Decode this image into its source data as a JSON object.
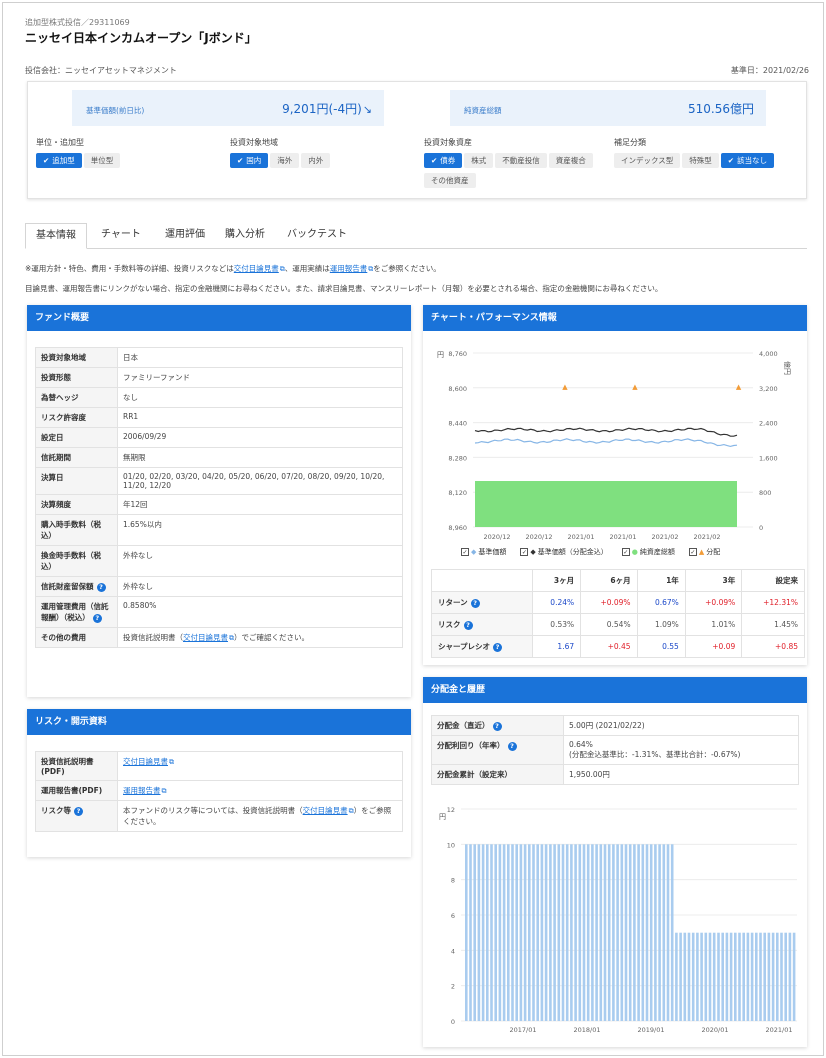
{
  "header": {
    "breadcrumb": "追加型株式投信／29311069",
    "title": "ニッセイ日本インカムオープン「Jボンド」",
    "company": "投信会社：ニッセイアセットマネジメント",
    "base_date": "基準日：2021/02/26"
  },
  "summary": {
    "nav_label": "基準価額(前日比)",
    "nav_value": "9,201円(-4円)",
    "nav_arrow": "↘",
    "assets_label": "純資産総額",
    "assets_value": "510.56億円"
  },
  "filters": [
    {
      "title": "単位・追加型",
      "chips": [
        {
          "label": "追加型",
          "on": true
        },
        {
          "label": "単位型",
          "on": false
        }
      ]
    },
    {
      "title": "投資対象地域",
      "chips": [
        {
          "label": "国内",
          "on": true
        },
        {
          "label": "海外",
          "on": false
        },
        {
          "label": "内外",
          "on": false
        }
      ]
    },
    {
      "title": "投資対象資産",
      "chips": [
        {
          "label": "債券",
          "on": true
        },
        {
          "label": "株式",
          "on": false
        },
        {
          "label": "不動産投信",
          "on": false
        },
        {
          "label": "資産複合",
          "on": false
        },
        {
          "label": "その他資産",
          "on": false
        }
      ]
    },
    {
      "title": "補足分類",
      "chips": [
        {
          "label": "インデックス型",
          "on": false
        },
        {
          "label": "特殊型",
          "on": false
        },
        {
          "label": "該当なし",
          "on": true
        }
      ]
    }
  ],
  "tabs": [
    "基本情報",
    "チャート",
    "運用評価",
    "購入分析",
    "バックテスト"
  ],
  "notes": {
    "line1_pre": "※運用方針・特色、費用・手数料等の詳細、投資リスクなどは",
    "line1_link1": "交付目論見書",
    "line1_mid": "、運用実績は",
    "line1_link2": "運用報告書",
    "line1_post": "をご参照ください。",
    "line2": "目論見書、運用報告書にリンクがない場合、指定の金融機関にお尋ねください。また、請求目論見書、マンスリーレポート（月報）を必要とされる場合、指定の金融機関にお尋ねください。"
  },
  "fund_overview": {
    "title": "ファンド概要",
    "rows": [
      {
        "k": "投資対象地域",
        "v": "日本"
      },
      {
        "k": "投資形態",
        "v": "ファミリーファンド"
      },
      {
        "k": "為替ヘッジ",
        "v": "なし"
      },
      {
        "k": "リスク許容度",
        "v": "RR1"
      },
      {
        "k": "設定日",
        "v": "2006/09/29"
      },
      {
        "k": "信託期間",
        "v": "無期限"
      },
      {
        "k": "決算日",
        "v": "01/20, 02/20, 03/20, 04/20, 05/20, 06/20, 07/20, 08/20, 09/20, 10/20, 11/20, 12/20"
      },
      {
        "k": "決算頻度",
        "v": "年12回"
      },
      {
        "k": "購入時手数料（税込）",
        "v": "1.65%以内"
      },
      {
        "k": "換金時手数料（税込）",
        "v": "外枠なし"
      },
      {
        "k": "信託財産留保額",
        "v": "外枠なし"
      },
      {
        "k": "運用管理費用（信託報酬）（税込）",
        "v": "0.8580%"
      },
      {
        "k": "その他の費用",
        "v_pre": "投資信託説明書（",
        "v_link": "交付目論見書",
        "v_post": "）でご確認ください。"
      }
    ]
  },
  "risk_docs": {
    "title": "リスク・開示資料",
    "rows": [
      {
        "k": "投資信託説明書(PDF)",
        "link": "交付目論見書"
      },
      {
        "k": "運用報告書(PDF)",
        "link": "運用報告書"
      },
      {
        "k": "リスク等",
        "v_pre": "本ファンドのリスク等については、投資信託説明書（",
        "v_link": "交付目論見書",
        "v_post": "）をご参照ください。"
      }
    ]
  },
  "chart_perf": {
    "title": "チャート・パフォーマンス情報",
    "left_unit": "円",
    "right_unit": "億円",
    "legend": [
      "基準価額",
      "基準価額（分配金込）",
      "純資産総額",
      "分配"
    ],
    "table": {
      "headers": [
        "3ヶ月",
        "6ヶ月",
        "1年",
        "3年",
        "設定来"
      ],
      "rows": [
        {
          "label": "リターン",
          "values": [
            "0.24%",
            "+0.09%",
            "0.67%",
            "+0.09%",
            "+12.31%"
          ],
          "tones": [
            "pos",
            "neg",
            "pos",
            "neg",
            "neg"
          ]
        },
        {
          "label": "リスク",
          "values": [
            "0.53%",
            "0.54%",
            "1.09%",
            "1.01%",
            "1.45%"
          ],
          "tones": [
            "neu",
            "neu",
            "neu",
            "neu",
            "neu"
          ]
        },
        {
          "label": "シャープレシオ",
          "values": [
            "1.67",
            "+0.45",
            "0.55",
            "+0.09",
            "+0.85"
          ],
          "tones": [
            "pos",
            "neg",
            "pos",
            "neg",
            "neg"
          ]
        }
      ]
    }
  },
  "chart_data": [
    {
      "type": "line",
      "x": [
        "2020/12",
        "2020/12",
        "2021/01",
        "2021/01",
        "2021/02",
        "2021/02"
      ],
      "y_left_ticks": [
        "8,760",
        "8,600",
        "8,440",
        "8,280",
        "8,120",
        "8,960"
      ],
      "y_right_ticks": [
        "4,000",
        "3,200",
        "2,400",
        "1,600",
        "800",
        "0"
      ],
      "series": [
        {
          "name": "基準価額",
          "color": "#87b6e6"
        },
        {
          "name": "基準価額（分配金込）",
          "color": "#333333"
        },
        {
          "name": "純資産総額",
          "color": "#7fe07f"
        },
        {
          "name": "分配",
          "color": "#f29c38"
        }
      ]
    },
    {
      "type": "bar",
      "x_ticks": [
        "2017/01",
        "2018/01",
        "2019/01",
        "2020/01",
        "2021/01"
      ],
      "y_ticks": [
        "12",
        "10",
        "8",
        "6",
        "4",
        "2",
        "0"
      ],
      "ylabel": "円",
      "ylim": [
        0,
        12
      ],
      "series": [
        {
          "segment": "early",
          "value": 10,
          "count": 50
        },
        {
          "segment": "late",
          "value": 5,
          "count": 29
        }
      ]
    }
  ],
  "dividend": {
    "title": "分配金と履歴",
    "rows": [
      {
        "k": "分配金（直近）",
        "v": "5.00円 (2021/02/22)",
        "help": true
      },
      {
        "k": "分配利回り（年率）",
        "v": "0.64%",
        "v2": "(分配金込基準比：-1.31%、基準比合計：-0.67%)",
        "help": true
      },
      {
        "k": "分配金累計（設定来）",
        "v": "1,950.00円",
        "help": false
      }
    ]
  }
}
